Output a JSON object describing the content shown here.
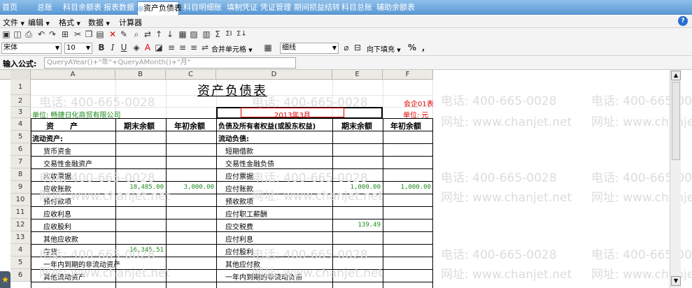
{
  "tabs": [
    "首页",
    "总账",
    "科目余额表",
    "报表数据",
    "资产负债表",
    "科目明细账",
    "填制凭证",
    "凭证管理",
    "期间损益结转",
    "科目总账",
    "辅助余额表"
  ],
  "active_tab": "资产负债表",
  "menus": [
    "文件",
    "编辑",
    "格式",
    "数据",
    "计算器"
  ],
  "toolbar": {
    "font_family": "宋体",
    "font_size": "10",
    "merge_center": "合并单元格",
    "border_style": "细线",
    "fill_down": "向下填充"
  },
  "formula": {
    "label": "输入公式:",
    "value": "QueryAYear()+\"年\"+QueryAMonth()+\"月\""
  },
  "watermark": {
    "phone": "电话: 400-665-0028",
    "site": "网址: www.chanjet.net"
  },
  "columns": [
    "A",
    "B",
    "C",
    "D",
    "E",
    "F"
  ],
  "rows": [
    "1",
    "2",
    "3",
    "4",
    "5",
    "6",
    "7",
    "8",
    "9",
    "10",
    "11",
    "12",
    "13",
    "4",
    "5",
    "6"
  ],
  "sheet": {
    "title": "资产负债表",
    "form_no": "会企01表",
    "company": "单位: 畅捷日化商贸有限公司",
    "period": "2013年3月",
    "unit": "单位: 元",
    "headers": [
      "资      产",
      "期末余额",
      "年初余额",
      "负债及所有者权益(或股东权益)",
      "期末余额",
      "年初余额"
    ],
    "left_section": "流动资产:",
    "right_section": "流动负债:",
    "left_items": [
      "货币资金",
      "交易性金融资产",
      "应收票据",
      "应收账款",
      "预付款项",
      "应收利息",
      "应收股利",
      "其他应收款",
      "存货",
      "一年内到期的非流动资产",
      "其他流动资产"
    ],
    "right_items": [
      "短期借款",
      "交易性金融负债",
      "应付票据",
      "应付账款",
      "预收款项",
      "应付职工薪酬",
      "应交税费",
      "应付利息",
      "应付股利",
      "其他应付款",
      "一年内到期的非流动负债"
    ],
    "vals": {
      "receivable_end": "18,485.00",
      "receivable_begin": "3,000.00",
      "inventory_end": "16,345.51",
      "payable_end": "1,000.00",
      "payable_begin": "1,000.00",
      "tax_end": "139.49"
    }
  }
}
